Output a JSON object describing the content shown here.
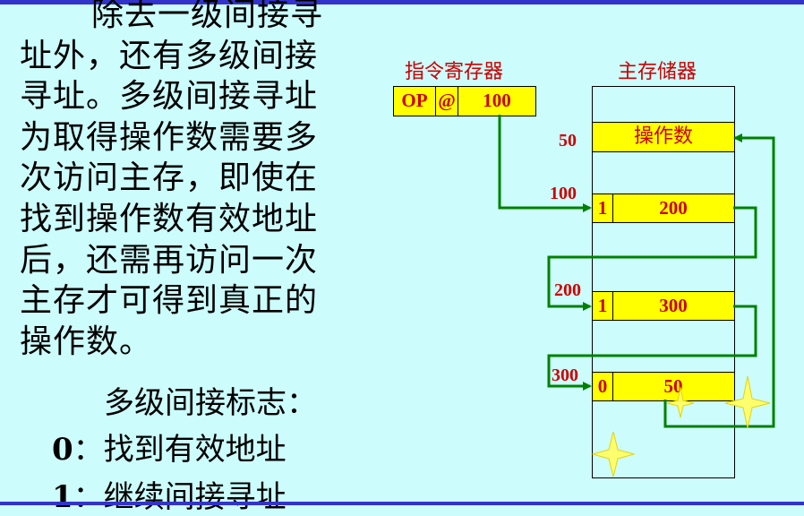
{
  "body_text": {
    "lines": [
      "除去一级间接寻",
      "址外，还有多级间接",
      "寻址。多级间接寻址",
      "为取得操作数需要多",
      "次访问主存，即使在",
      "找到操作数有效地址",
      "后，还需再访问一次",
      "主存才可得到真正的",
      "操作数。"
    ],
    "flag_title": "多级间接标志：",
    "flags": [
      {
        "num": "0",
        "text": "：找到有效地址"
      },
      {
        "num": "1",
        "text": "：继续间接寻址"
      }
    ]
  },
  "instruction_register": {
    "label": "指令寄存器",
    "op": "OP",
    "at": "@",
    "addr": "100"
  },
  "main_memory": {
    "label": "主存储器",
    "cells": [
      {
        "address": "50",
        "flag": "",
        "value": "操作数"
      },
      {
        "address": "100",
        "flag": "1",
        "value": "200"
      },
      {
        "address": "200",
        "flag": "1",
        "value": "300"
      },
      {
        "address": "300",
        "flag": "0",
        "value": "50"
      }
    ]
  },
  "colors": {
    "background": "#ccfcfc",
    "cell_fill": "#ffff00",
    "label_red": "#cc0000",
    "arrow_green": "#008000",
    "bar_blue": "#3333cc"
  }
}
